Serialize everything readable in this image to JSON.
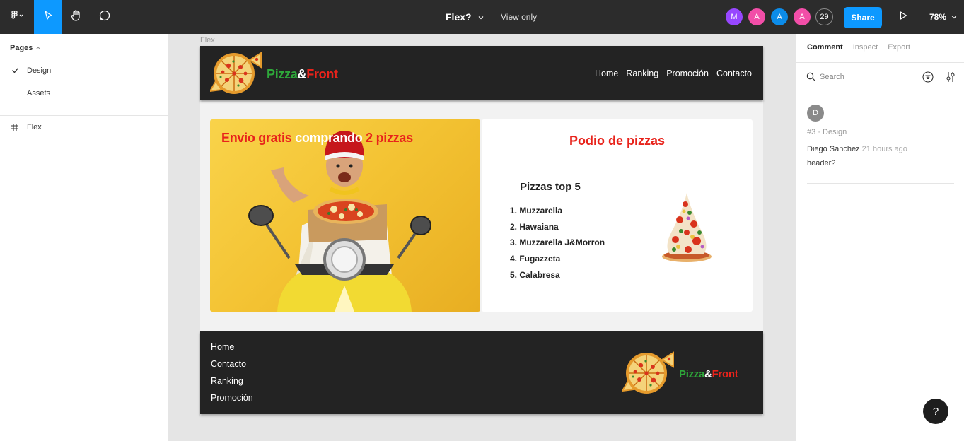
{
  "toolbar": {
    "file_name": "Flex?",
    "view_mode": "View only",
    "share_label": "Share",
    "zoom": "78%",
    "collaborators": [
      {
        "initial": "M",
        "color": "#9747ff"
      },
      {
        "initial": "A",
        "color": "#f24ea8"
      },
      {
        "initial": "A",
        "color": "#0c8ce9"
      },
      {
        "initial": "A",
        "color": "#f24ea8"
      }
    ],
    "collaborator_count": "29",
    "icons": [
      "figma-menu-icon",
      "move-tool-icon",
      "hand-tool-icon",
      "comment-tool-icon",
      "chevron-down-icon",
      "present-play-icon"
    ]
  },
  "left_panel": {
    "pages_label": "Pages",
    "pages": [
      {
        "label": "Design",
        "selected": true
      },
      {
        "label": "Assets",
        "selected": false
      }
    ],
    "layers": [
      {
        "label": "Flex",
        "icon": "frame-hash-icon"
      }
    ]
  },
  "canvas": {
    "frame_label": "Flex",
    "site": {
      "brand": {
        "part1": "Pizza",
        "amp": "&",
        "part2": "Front"
      },
      "nav": [
        "Home",
        "Ranking",
        "Promoción",
        "Contacto"
      ],
      "promo": {
        "part1": "Envio gratis ",
        "part2": "comprando ",
        "part3": "2 pizzas"
      },
      "podium_title": "Podio de pizzas",
      "top5_title": "Pizzas top 5",
      "top5": [
        "1. Muzzarella",
        "2. Hawaiana",
        "3. Muzzarella J&Morron",
        "4. Fugazzeta",
        "5. Calabresa"
      ],
      "footer_links": [
        "Home",
        "Contacto",
        "Ranking",
        "Promoción"
      ],
      "colors": {
        "green": "#2ea83a",
        "red": "#e8231b",
        "dark": "#232323",
        "yellow": "#f3c232"
      }
    }
  },
  "right_panel": {
    "tabs": [
      {
        "label": "Comment",
        "active": true
      },
      {
        "label": "Inspect",
        "active": false
      },
      {
        "label": "Export",
        "active": false
      }
    ],
    "search_placeholder": "Search",
    "comment": {
      "avatar_initial": "D",
      "meta": "#3 · Design",
      "author": "Diego Sanchez",
      "time": "21 hours ago",
      "text": "header?"
    },
    "help_label": "?"
  }
}
